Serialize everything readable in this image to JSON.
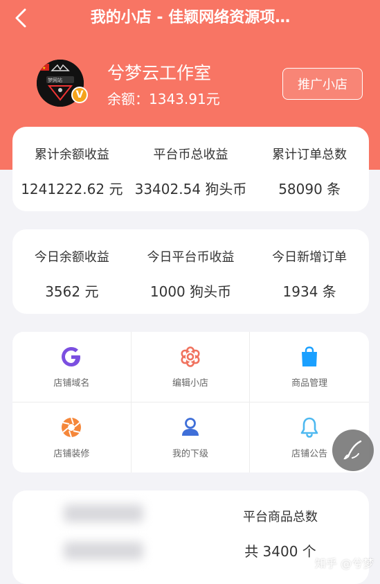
{
  "header": {
    "title": "我的小店 - 佳颖网络资源项…",
    "bg_color": "#f87564"
  },
  "shop": {
    "name": "兮梦云工作室",
    "balance_label": "余额：",
    "balance_value": "1343.91元",
    "vip_badge": "V",
    "promote_label": "推广小店"
  },
  "totals": [
    {
      "label": "累计余额收益",
      "value": "1241222.62 元"
    },
    {
      "label": "平台币总收益",
      "value": "33402.54 狗头币"
    },
    {
      "label": "累计订单总数",
      "value": "58090 条"
    }
  ],
  "today": [
    {
      "label": "今日余额收益",
      "value": "3562 元"
    },
    {
      "label": "今日平台币收益",
      "value": "1000 狗头币"
    },
    {
      "label": "今日新增订单",
      "value": "1934 条"
    }
  ],
  "menu": [
    {
      "label": "店铺域名",
      "icon": "g-letter-icon",
      "color": "#7b4fe0"
    },
    {
      "label": "编辑小店",
      "icon": "flower-gear-icon",
      "color": "#f0725e"
    },
    {
      "label": "商品管理",
      "icon": "shopping-bag-icon",
      "color": "#1aa0ff"
    },
    {
      "label": "店铺装修",
      "icon": "aperture-icon",
      "color": "#f5873a"
    },
    {
      "label": "我的下级",
      "icon": "user-icon",
      "color": "#3f6fd8"
    },
    {
      "label": "店铺公告",
      "icon": "bell-icon",
      "color": "#4db8f0"
    }
  ],
  "platform": {
    "label": "平台商品总数",
    "value": "共 3400 个"
  },
  "watermark": "知乎 @兮梦"
}
